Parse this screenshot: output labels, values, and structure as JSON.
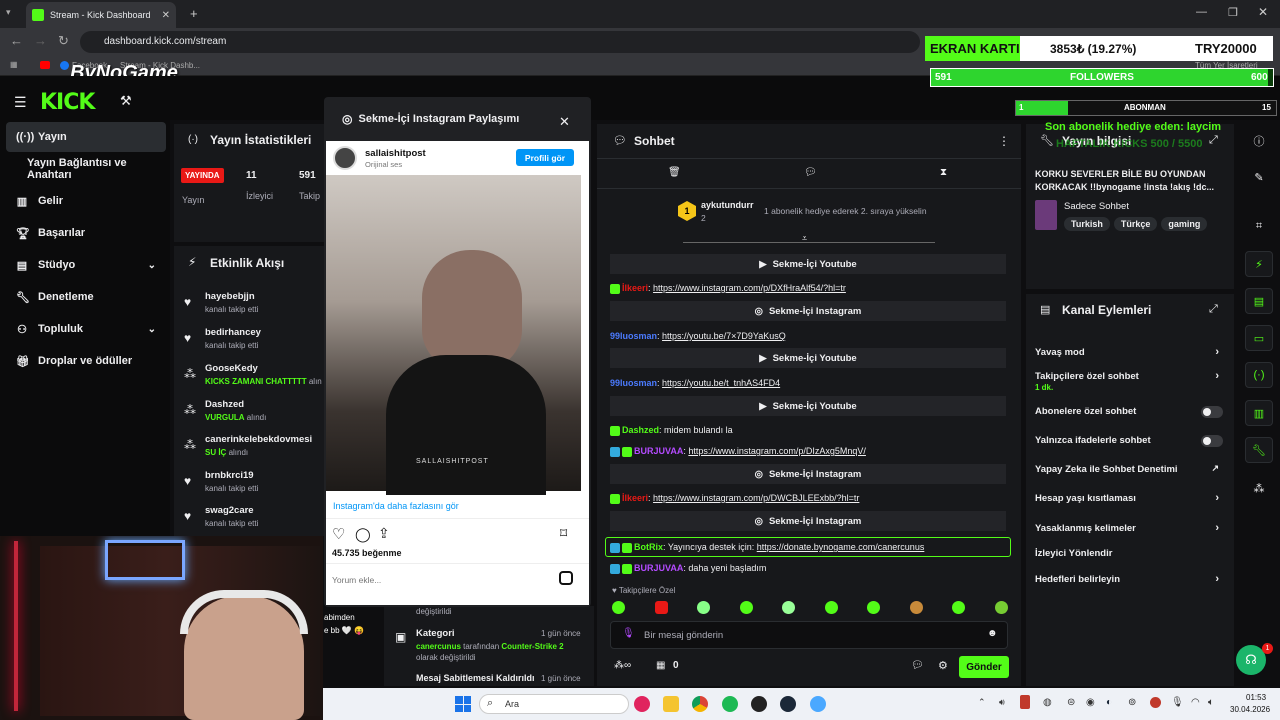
{
  "browser": {
    "tab_title": "Stream - Kick Dashboard",
    "url": "dashboard.kick.com/stream",
    "bookmark_1": "Facebook",
    "bookmark_2": "Stream - Kick Dashb...",
    "bookmark_all": "Tüm Yer İşaretleri"
  },
  "overlay": {
    "watermark": "ByNoGame",
    "ekran_label": "EKRAN KARTI",
    "ekran_amount": "3853₺ (19.27%)",
    "ekran_goal": "TRY20000",
    "followers_current": "591",
    "followers_label": "FOLLOWERS",
    "followers_goal": "600",
    "followers_progress": 0.985,
    "abone_current": "1",
    "abone_label": "ABONMAN",
    "abone_goal": "15",
    "abone_progress": 0.2,
    "last_sub": "Son abonelik hediye eden: laycim",
    "kicks_banner": "HAFTALIK KICKS 500 / 5500"
  },
  "sidebar": {
    "items": [
      {
        "label": "Yayın",
        "icon": "broadcast-icon"
      },
      {
        "label": "Yayın Bağlantısı ve Anahtarı"
      },
      {
        "label": "Gelir",
        "icon": "chart-icon"
      },
      {
        "label": "Başarılar",
        "icon": "trophy-icon"
      },
      {
        "label": "Stüdyo",
        "icon": "studio-icon"
      },
      {
        "label": "Denetleme",
        "icon": "wrench-icon"
      },
      {
        "label": "Topluluk",
        "icon": "community-icon"
      },
      {
        "label": "Droplar ve ödüller",
        "icon": "gift-icon"
      }
    ]
  },
  "stats": {
    "title": "Yayın İstatistikleri",
    "live": "YAYINDA",
    "live_label": "Yayın",
    "viewers": "11",
    "viewers_label": "İzleyici",
    "followers": "591",
    "followers_label": "Takip"
  },
  "activity": {
    "title": "Etkinlik Akışı",
    "items": [
      {
        "name": "hayebebjjn",
        "sub": "kanalı takip etti"
      },
      {
        "name": "bedirhancey",
        "sub": "kanalı takip etti"
      },
      {
        "name": "GooseKedy",
        "reward": "KICKS ZAMANI CHATTTTT",
        "sub": " alın"
      },
      {
        "name": "Dashzed",
        "reward": "VURGULA",
        "sub": " alındı"
      },
      {
        "name": "canerinkelebekdovmesi",
        "reward": "SU İÇ",
        "sub": " alındı"
      },
      {
        "name": "brnbkrci19",
        "sub": "kanalı takip etti"
      },
      {
        "name": "swag2care",
        "sub": "kanalı takip etti"
      }
    ],
    "partial_1": "abimden",
    "partial_2": "e bb 🤍 😝",
    "partial_3": "değiştirildi",
    "kategori_title": "Kategori",
    "kategori_time": "1 gün önce",
    "kategori_user": "canercunus",
    "kategori_mid": " tarafından ",
    "kategori_game": "Counter-Strike 2",
    "kategori_end": "olarak değiştirildi",
    "pinned_title": "Mesaj Sabitlemesi Kaldırıldı",
    "pinned_time": "1 gün önce"
  },
  "instagram": {
    "header": "Sekme-İçi Instagram Paylaşımı",
    "user": "sallaishitpost",
    "sub": "Orijinal ses",
    "profile_btn": "Profili gör",
    "video_watermark": "SALLAISHITPOST",
    "more": "Instagram'da daha fazlasını gör",
    "likes": "45.735 beğenme",
    "comment_placeholder": "Yorum ekle..."
  },
  "chat": {
    "title": "Sohbet",
    "gift_user": "aykutundurr",
    "gift_count": "2",
    "gift_text": "1 abonelik hediye ederek 2. sıraya yükselin",
    "messages": [
      {
        "type": "sys",
        "text": "Sekme-İçi Youtube"
      },
      {
        "type": "msg",
        "user": "İlkeeri",
        "text": "https://www.instagram.com/p/DXfHraAlf54/?hl=tr"
      },
      {
        "type": "sys",
        "text": "Sekme-İçi Instagram"
      },
      {
        "type": "msg",
        "user": "99luosman",
        "text": "https://youtu.be/7×7D9YaKusQ"
      },
      {
        "type": "sys",
        "text": "Sekme-İçi Youtube"
      },
      {
        "type": "msg",
        "user": "99luosman",
        "text": "https://youtu.be/t_tnhAS4FD4"
      },
      {
        "type": "sys",
        "text": "Sekme-İçi Youtube"
      },
      {
        "type": "msg",
        "user": "Dashzed",
        "text": "midem bulandı la"
      },
      {
        "type": "msg",
        "user": "BURJUVAA",
        "text": "https://www.instagram.com/p/DIzAxg5MnqV/"
      },
      {
        "type": "sys",
        "text": "Sekme-İçi Instagram"
      },
      {
        "type": "msg",
        "user": "İlkeeri",
        "text": "https://www.instagram.com/p/DWCBJLEExbb/?hl=tr"
      },
      {
        "type": "sys",
        "text": "Sekme-İçi Instagram"
      },
      {
        "type": "msg",
        "user": "BotRix",
        "text": "Yayıncıya destek için: ",
        "link": "https://donate.bynogame.com/canercunus"
      },
      {
        "type": "msg",
        "user": "BURJUVAA",
        "text": "daha yeni başladım"
      }
    ],
    "followers_only": "Takipçilere Özel",
    "input_placeholder": "Bir mesaj gönderin",
    "kicks_count": "0",
    "send": "Gönder"
  },
  "info": {
    "title": "Yayın bilgisi",
    "stream_title": "KORKU SEVERLER BİLE BU OYUNDAN KORKACAK !!bynogame !insta !akış !dc...",
    "category": "Sadece Sohbet",
    "tags": [
      "Turkish",
      "Türkçe",
      "gaming"
    ]
  },
  "actions": {
    "title": "Kanal Eylemleri",
    "rows": [
      {
        "label": "Yavaş mod",
        "kind": "arrow"
      },
      {
        "label": "Takipçilere özel sohbet",
        "sub": "1 dk.",
        "kind": "arrow"
      },
      {
        "label": "Abonelere özel sohbet",
        "kind": "toggle"
      },
      {
        "label": "Yalnızca ifadelerle sohbet",
        "kind": "toggle"
      },
      {
        "label": "Yapay Zeka ile Sohbet Denetimi",
        "kind": "ext"
      },
      {
        "label": "Hesap yaşı kısıtlaması",
        "kind": "arrow"
      },
      {
        "label": "Yasaklanmış kelimeler",
        "kind": "arrow"
      },
      {
        "label": "İzleyici Yönlendir",
        "kind": "none"
      },
      {
        "label": "Hedefleri belirleyin",
        "kind": "arrow"
      }
    ]
  },
  "taskbar": {
    "search": "Ara",
    "time": "01:53",
    "date": "30.04.2026",
    "help_badge": "1"
  },
  "colors": {
    "kick_green": "#53fc18",
    "live_red": "#e91916",
    "panel": "#17181b",
    "bg": "#0e0e10"
  }
}
